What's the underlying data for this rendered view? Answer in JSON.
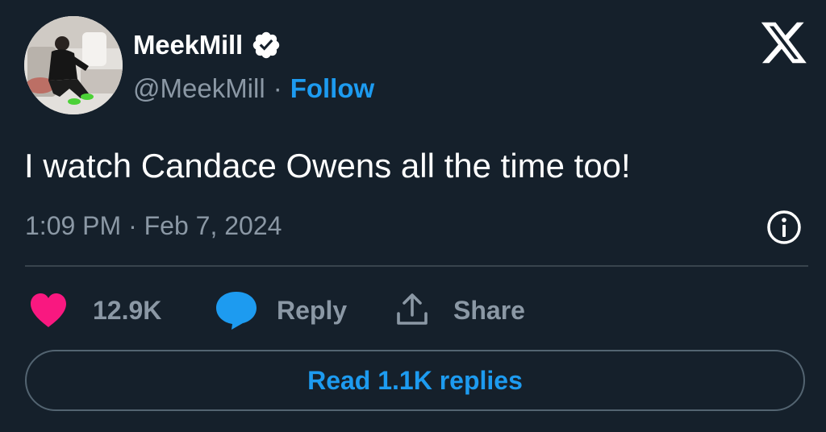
{
  "author": {
    "display_name": "MeekMill",
    "handle": "@MeekMill",
    "verified": true,
    "avatar_icon": "profile-photo"
  },
  "header": {
    "separator": "·",
    "follow_label": "Follow",
    "logo_icon": "x-logo-icon"
  },
  "tweet": {
    "text": "I watch Candace Owens all the time too!",
    "timestamp": "1:09 PM · Feb 7, 2024",
    "info_icon": "info-icon"
  },
  "actions": {
    "like_count": "12.9K",
    "reply_label": "Reply",
    "share_label": "Share"
  },
  "footer": {
    "read_replies_label": "Read 1.1K replies"
  },
  "colors": {
    "background": "#15202b",
    "text_primary": "#ffffff",
    "text_secondary": "#8b98a5",
    "accent_blue": "#1d9bf0",
    "like_pink": "#f91880",
    "divider": "#38444d"
  }
}
